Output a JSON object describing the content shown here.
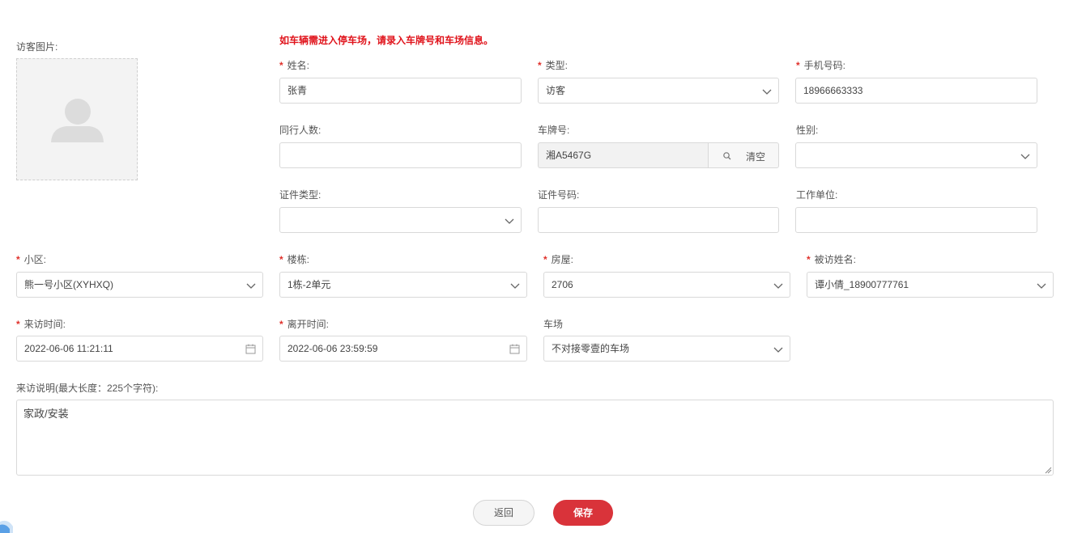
{
  "photo": {
    "label": "访客图片:"
  },
  "notice": "如车辆需进入停车场，请录入车牌号和车场信息。",
  "fields": {
    "name": {
      "label": "姓名:",
      "value": "张青",
      "required": true
    },
    "type": {
      "label": "类型:",
      "value": "访客",
      "required": true
    },
    "phone": {
      "label": "手机号码:",
      "value": "18966663333",
      "required": true
    },
    "companions": {
      "label": "同行人数:",
      "value": ""
    },
    "plate": {
      "label": "车牌号:",
      "value": "湘A5467G",
      "clear_label": "清空"
    },
    "gender": {
      "label": "性别:",
      "value": ""
    },
    "id_type": {
      "label": "证件类型:",
      "value": ""
    },
    "id_number": {
      "label": "证件号码:",
      "value": ""
    },
    "employer": {
      "label": "工作单位:",
      "value": ""
    },
    "community": {
      "label": "小区:",
      "value": "熊一号小区(XYHXQ)",
      "required": true
    },
    "building": {
      "label": "楼栋:",
      "value": "1栋-2单元",
      "required": true
    },
    "house": {
      "label": "房屋:",
      "value": "2706",
      "required": true
    },
    "host": {
      "label": "被访姓名:",
      "value": "谭小倩_18900777761",
      "required": true
    },
    "visit_time": {
      "label": "来访时间:",
      "value": "2022-06-06 11:21:11",
      "required": true
    },
    "leave_time": {
      "label": "离开时间:",
      "value": "2022-06-06 23:59:59",
      "required": true
    },
    "parking": {
      "label": "车场",
      "value": "不对接零壹的车场"
    },
    "description": {
      "label": "来访说明(最大长度：225个字符):",
      "value": "家政/安装"
    }
  },
  "buttons": {
    "back": "返回",
    "save": "保存"
  },
  "colors": {
    "required": "#e0312b",
    "notice": "#e0141c",
    "primary": "#d9333a"
  }
}
